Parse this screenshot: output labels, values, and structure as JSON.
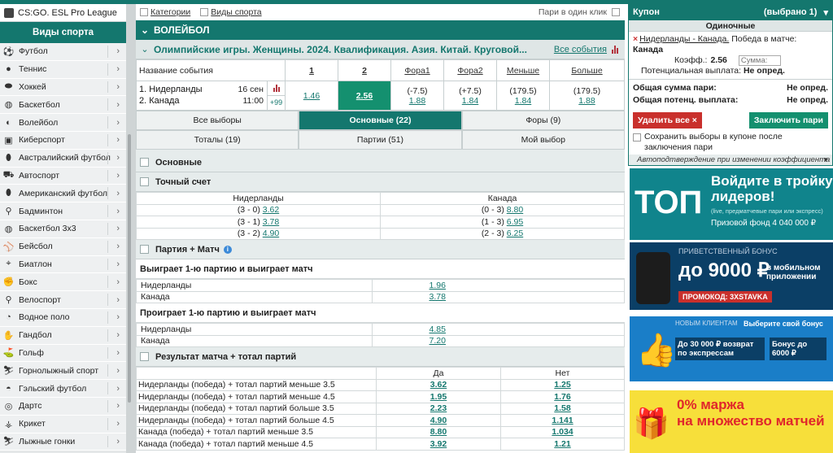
{
  "sidebar": {
    "top_item": "CS:GO. ESL Pro League",
    "header": "Виды спорта",
    "items": [
      {
        "label": "Футбол",
        "icon": "soccer-ball-icon"
      },
      {
        "label": "Теннис",
        "icon": "tennis-ball-icon"
      },
      {
        "label": "Хоккей",
        "icon": "hockey-puck-icon"
      },
      {
        "label": "Баскетбол",
        "icon": "basketball-icon"
      },
      {
        "label": "Волейбол",
        "icon": "volleyball-icon"
      },
      {
        "label": "Киберспорт",
        "icon": "gamepad-icon"
      },
      {
        "label": "Австралийский футбол",
        "icon": "aussie-football-icon"
      },
      {
        "label": "Автоспорт",
        "icon": "car-icon"
      },
      {
        "label": "Американский футбол",
        "icon": "american-football-icon"
      },
      {
        "label": "Бадминтон",
        "icon": "shuttlecock-icon"
      },
      {
        "label": "Баскетбол 3x3",
        "icon": "basketball-3x3-icon"
      },
      {
        "label": "Бейсбол",
        "icon": "baseball-icon"
      },
      {
        "label": "Биатлон",
        "icon": "biathlon-icon"
      },
      {
        "label": "Бокс",
        "icon": "boxing-glove-icon"
      },
      {
        "label": "Велоспорт",
        "icon": "bicycle-icon"
      },
      {
        "label": "Водное поло",
        "icon": "water-polo-icon"
      },
      {
        "label": "Гандбол",
        "icon": "handball-icon"
      },
      {
        "label": "Гольф",
        "icon": "golf-icon"
      },
      {
        "label": "Горнолыжный спорт",
        "icon": "ski-icon"
      },
      {
        "label": "Гэльский футбол",
        "icon": "gaelic-football-icon"
      },
      {
        "label": "Дартс",
        "icon": "darts-icon"
      },
      {
        "label": "Крикет",
        "icon": "cricket-icon"
      },
      {
        "label": "Лыжные гонки",
        "icon": "cross-country-ski-icon"
      }
    ]
  },
  "filters": {
    "categories": "Категории",
    "sports": "Виды спорта",
    "one_click": "Пари в один клик"
  },
  "sport_title": "ВОЛЕЙБОЛ",
  "competition": {
    "title": "Олимпийские игры. Женщины. 2024. Квалификация. Азия. Китай. Круговой...",
    "all_events": "Все события"
  },
  "event_table": {
    "headers": [
      "Название события",
      "1",
      "2",
      "Фора1",
      "Фора2",
      "Меньше",
      "Больше"
    ],
    "team1": "1. Нидерланды",
    "team2": "2. Канада",
    "date": "16 сен",
    "time": "11:00",
    "more": "+99",
    "odds": [
      "1.46",
      "2.56"
    ],
    "fora1": {
      "line": "(-7.5)",
      "odd": "1.88"
    },
    "fora2": {
      "line": "(+7.5)",
      "odd": "1.84"
    },
    "under": {
      "line": "(179.5)",
      "odd": "1.84"
    },
    "over": {
      "line": "(179.5)",
      "odd": "1.88"
    }
  },
  "tabs_row1": [
    "Все выборы",
    "Основные (22)",
    "Форы (9)"
  ],
  "tabs_row2": [
    "Тоталы (19)",
    "Партии (51)",
    "Мой выбор"
  ],
  "sections": {
    "main": "Основные",
    "exact": "Точный счет",
    "exact_headers": [
      "Нидерланды",
      "Канада"
    ],
    "exact_rows": [
      {
        "l": "(3 - 0)",
        "lo": "3.62",
        "r": "(0 - 3)",
        "ro": "8.80"
      },
      {
        "l": "(3 - 1)",
        "lo": "3.78",
        "r": "(1 - 3)",
        "ro": "6.95"
      },
      {
        "l": "(3 - 2)",
        "lo": "4.90",
        "r": "(2 - 3)",
        "ro": "6.25"
      }
    ],
    "set_match": "Партия + Матч",
    "win1": "Выиграет 1-ю партию и выиграет матч",
    "win1_rows": [
      {
        "t": "Нидерланды",
        "o": "1.96"
      },
      {
        "t": "Канада",
        "o": "3.78"
      }
    ],
    "lose1": "Проиграет 1-ю партию и выиграет матч",
    "lose1_rows": [
      {
        "t": "Нидерланды",
        "o": "4.85"
      },
      {
        "t": "Канада",
        "o": "7.20"
      }
    ],
    "result_total": "Результат матча + тотал партий",
    "rt_headers": [
      "Да",
      "Нет"
    ],
    "rt_rows": [
      {
        "t": "Нидерланды (победа) + тотал партий меньше 3.5",
        "y": "3.62",
        "n": "1.25"
      },
      {
        "t": "Нидерланды (победа) + тотал партий меньше 4.5",
        "y": "1.95",
        "n": "1.76"
      },
      {
        "t": "Нидерланды (победа) + тотал партий больше 3.5",
        "y": "2.23",
        "n": "1.58"
      },
      {
        "t": "Нидерланды (победа) + тотал партий больше 4.5",
        "y": "4.90",
        "n": "1.141"
      },
      {
        "t": "Канада (победа) + тотал партий меньше 3.5",
        "y": "8.80",
        "n": "1.034"
      },
      {
        "t": "Канада (победа) + тотал партий меньше 4.5",
        "y": "3.92",
        "n": "1.21"
      }
    ]
  },
  "coupon": {
    "title": "Купон",
    "selected": "(выбрано 1)",
    "singles": "Одиночные",
    "match": "Нидерланды - Канада.",
    "pick": "Победа в матче:",
    "pick_team": "Канада",
    "coef_label": "Коэфф.:",
    "coef": "2.56",
    "sum_placeholder": "Сумма:",
    "potential_label": "Потенциальная выплата:",
    "potential": "Не опред.",
    "total_label": "Общая сумма пари:",
    "total": "Не опред.",
    "total_pot_label": "Общая потенц. выплата:",
    "total_pot": "Не опред.",
    "delete_all": "Удалить все",
    "place": "Заключить пари",
    "save_text": "Сохранить выборы в купоне после заключения пари",
    "auto": "Автоподтверждение при изменении коэффициента"
  },
  "ads": [
    {
      "l1": "Войдите в тройку",
      "l2": "лидеров!",
      "l3": "(live, предматчевые пари или экспресс)",
      "l4": "Призовой фонд 4 040 000 ₽",
      "logo": "ТОП"
    },
    {
      "l1": "ПРИВЕТСТВЕННЫЙ БОНУС",
      "l2": "до 9000 ₽",
      "l3": "в мобильном приложении",
      "l4": "ПРОМОКОД: 3XSTAVKA"
    },
    {
      "l1": "НОВЫМ КЛИЕНТАМ",
      "l2": "Выберите свой бонус",
      "l3": "До 30 000 ₽ возврат по экспрессам",
      "l4": "Бонус до 6000 ₽"
    },
    {
      "l1": "0% маржа",
      "l2": "на множество матчей"
    }
  ]
}
